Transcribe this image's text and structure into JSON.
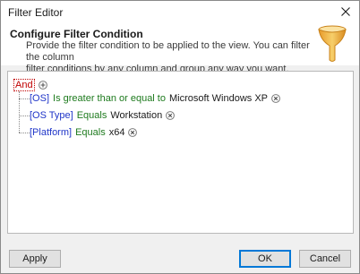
{
  "window": {
    "title": "Filter Editor",
    "close_icon": "close-icon"
  },
  "header": {
    "title": "Configure Filter Condition",
    "description_line1": "Provide the filter condition to be applied to the view. You can filter the column",
    "description_line2": "filter conditions by any column and group any way you want.",
    "icon": "funnel-icon"
  },
  "root": {
    "group_operator": "And",
    "add_icon": "add-condition-icon"
  },
  "conditions": [
    {
      "field": "[OS]",
      "operator": "Is greater than or equal to",
      "value": "Microsoft Windows XP",
      "remove_icon": "remove-condition-icon"
    },
    {
      "field": "[OS Type]",
      "operator": "Equals",
      "value": "Workstation",
      "remove_icon": "remove-condition-icon"
    },
    {
      "field": "[Platform]",
      "operator": "Equals",
      "value": "x64",
      "remove_icon": "remove-condition-icon"
    }
  ],
  "buttons": {
    "apply": "Apply",
    "ok": "OK",
    "cancel": "Cancel"
  },
  "colors": {
    "group_operator": "#c00000",
    "field": "#1f35c8",
    "operator": "#1d7a1d",
    "value": "#1a1a1a",
    "focus_border": "#0078d7"
  }
}
